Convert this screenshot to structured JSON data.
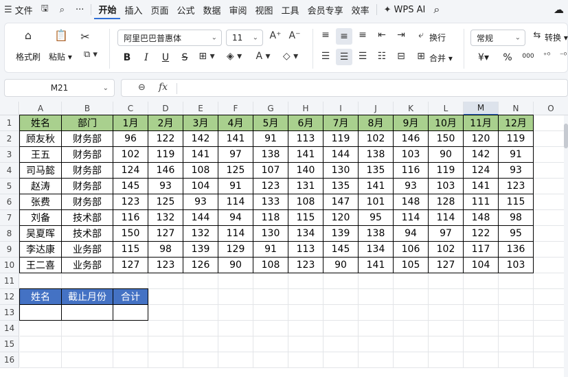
{
  "menubar": {
    "items": [
      {
        "label": "文件",
        "icon": "menu-icon"
      },
      {
        "label": "",
        "icon": "save-icon"
      },
      {
        "label": "",
        "icon": "format-painter-icon"
      },
      {
        "label": "···",
        "icon": "more-icon"
      },
      {
        "label": "开始",
        "active": true
      },
      {
        "label": "插入"
      },
      {
        "label": "页面"
      },
      {
        "label": "公式"
      },
      {
        "label": "数据"
      },
      {
        "label": "审阅"
      },
      {
        "label": "视图"
      },
      {
        "label": "工具"
      },
      {
        "label": "会员专享"
      },
      {
        "label": "效率"
      },
      {
        "label": "WPS AI",
        "icon": "wps-ai-icon"
      }
    ]
  },
  "ribbon": {
    "format_painter": "格式刷",
    "paste": "粘贴",
    "font_name": "阿里巴巴普惠体",
    "font_size": "11",
    "wrap": "换行",
    "merge": "合并",
    "number_format": "常规",
    "convert": "转换",
    "bold": "B",
    "italic": "I",
    "underline": "U",
    "strike": "S",
    "currency": "¥",
    "percent": "%",
    "thousands": "000"
  },
  "formula_bar": {
    "name_box": "M21",
    "fx": "fx",
    "formula": ""
  },
  "sheet": {
    "columns": [
      "A",
      "B",
      "C",
      "D",
      "E",
      "F",
      "G",
      "H",
      "I",
      "J",
      "K",
      "L",
      "M",
      "N",
      "O"
    ],
    "selected_column": "M",
    "rows": [
      "1",
      "2",
      "3",
      "4",
      "5",
      "6",
      "7",
      "8",
      "9",
      "10",
      "11",
      "12",
      "13",
      "14",
      "15",
      "16"
    ],
    "table1": {
      "headers": [
        "姓名",
        "部门",
        "1月",
        "2月",
        "3月",
        "4月",
        "5月",
        "6月",
        "7月",
        "8月",
        "9月",
        "10月",
        "11月",
        "12月"
      ],
      "rows": [
        [
          "顾友秋",
          "财务部",
          "96",
          "122",
          "142",
          "141",
          "91",
          "113",
          "119",
          "102",
          "146",
          "150",
          "120",
          "119"
        ],
        [
          "王五",
          "财务部",
          "102",
          "119",
          "141",
          "97",
          "138",
          "141",
          "144",
          "138",
          "103",
          "90",
          "142",
          "91"
        ],
        [
          "司马懿",
          "财务部",
          "124",
          "146",
          "108",
          "125",
          "107",
          "140",
          "130",
          "135",
          "116",
          "119",
          "124",
          "93"
        ],
        [
          "赵涛",
          "财务部",
          "145",
          "93",
          "104",
          "91",
          "123",
          "131",
          "135",
          "141",
          "93",
          "103",
          "141",
          "123"
        ],
        [
          "张费",
          "财务部",
          "123",
          "125",
          "93",
          "114",
          "133",
          "108",
          "147",
          "101",
          "148",
          "128",
          "111",
          "115"
        ],
        [
          "刘备",
          "技术部",
          "116",
          "132",
          "144",
          "94",
          "118",
          "115",
          "120",
          "95",
          "114",
          "114",
          "148",
          "98"
        ],
        [
          "吴夏晖",
          "技术部",
          "150",
          "127",
          "132",
          "114",
          "130",
          "134",
          "139",
          "138",
          "94",
          "97",
          "122",
          "95"
        ],
        [
          "李达康",
          "业务部",
          "115",
          "98",
          "139",
          "129",
          "91",
          "113",
          "145",
          "134",
          "106",
          "102",
          "117",
          "136"
        ],
        [
          "王二喜",
          "业务部",
          "127",
          "123",
          "126",
          "90",
          "108",
          "123",
          "90",
          "141",
          "105",
          "127",
          "104",
          "103"
        ]
      ]
    },
    "table2": {
      "headers": [
        "姓名",
        "截止月份",
        "合计"
      ],
      "row": [
        "",
        "",
        ""
      ]
    }
  },
  "colors": {
    "header_green": "#a9d08e",
    "header_blue": "#4472c4",
    "accent": "#2f6fd6"
  }
}
